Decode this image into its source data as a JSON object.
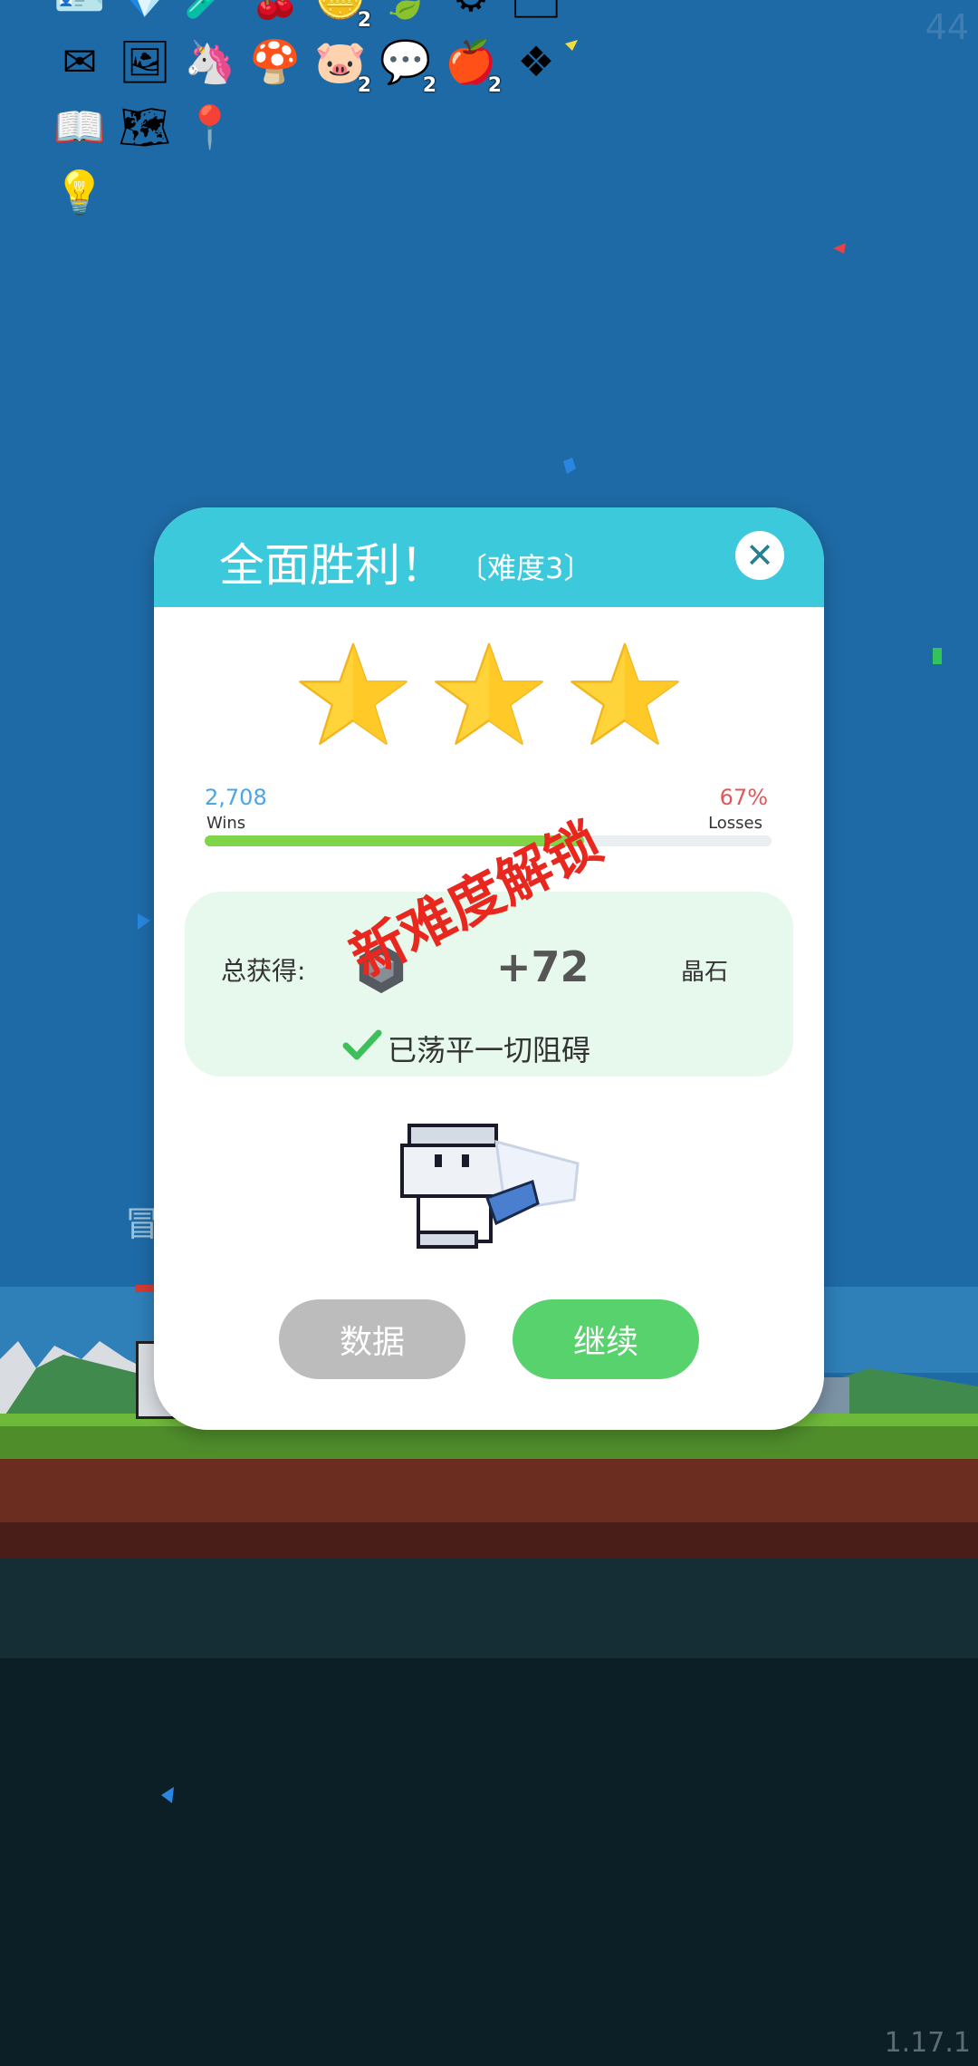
{
  "app": {
    "version": "1.17.1",
    "corner_counter": "44"
  },
  "inventory": {
    "rows": [
      [
        {
          "icon": "id-card-icon"
        },
        {
          "icon": "heart-gem-icon"
        },
        {
          "icon": "potion-icon"
        },
        {
          "icon": "red-item-icon"
        },
        {
          "icon": "coin-icon",
          "count": "2"
        },
        {
          "icon": "leaf-item-icon"
        },
        {
          "icon": "gear-item-icon"
        },
        {
          "icon": "card-icon"
        }
      ],
      [
        {
          "icon": "mail-icon"
        },
        {
          "icon": "photo-card-icon"
        },
        {
          "icon": "unicorn-icon"
        },
        {
          "icon": "mushroom-icon"
        },
        {
          "icon": "pig-icon",
          "count": "2"
        },
        {
          "icon": "chat-bubble-icon",
          "count": "2"
        },
        {
          "icon": "apple-icon",
          "count": "2"
        },
        {
          "icon": "molecule-icon"
        }
      ],
      [
        {
          "icon": "recipe-book-icon"
        },
        {
          "icon": "map-pencil-icon"
        },
        {
          "icon": "location-pin-icon"
        }
      ],
      [
        {
          "icon": "lightbulb-frame-icon"
        }
      ]
    ]
  },
  "modal": {
    "title": "全面胜利！",
    "difficulty": "〔难度3〕",
    "stars_earned": 3,
    "stars_total": 3,
    "wins_value": "2,708",
    "wins_label": "Wins",
    "losses_value": "67%",
    "losses_label": "Losses",
    "win_fraction": 0.67,
    "unlock_stamp": "新难度解锁",
    "reward": {
      "label": "总获得:",
      "amount": "+72",
      "unit": "晶石"
    },
    "cleared_text": "已荡平一切阻碍",
    "buttons": {
      "data": "数据",
      "continue": "继续"
    }
  },
  "colors": {
    "header": "#3dc9dc",
    "continue": "#57d26d",
    "data_button": "#bcbcbc",
    "stamp": "#e8281f",
    "wins": "#4aa6e4",
    "losses": "#e0585a",
    "progress": "#7ed548"
  }
}
